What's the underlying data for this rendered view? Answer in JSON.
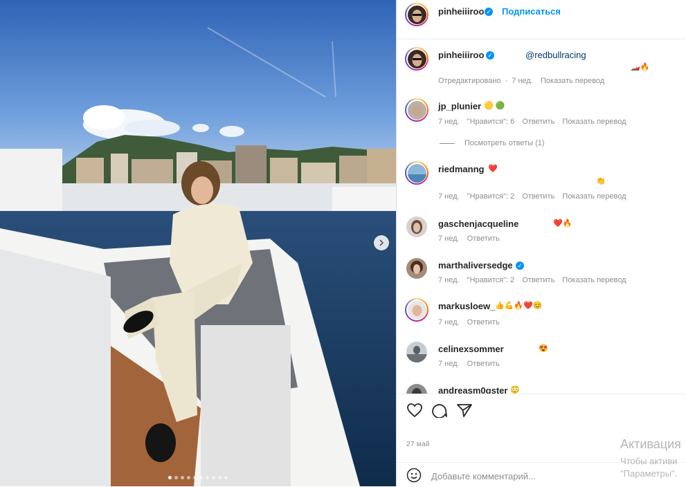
{
  "post": {
    "author": "pinheiiiroo",
    "follow_label": "Подписаться",
    "verified": true,
    "carousel": {
      "total_slides": 10,
      "active_slide": 1
    },
    "caption": {
      "username": "pinheiiiroo",
      "mention": "@redbullracing",
      "emojis": "🏎️🔥",
      "edited_label": "Отредактировано",
      "separator": "·",
      "time": "7 нед.",
      "translate_label": "Показать перевод"
    },
    "comments": [
      {
        "username": "jp_plunier",
        "verified": false,
        "text": "🟡 🟢",
        "time": "7 нед.",
        "likes": "\"Нравится\": 6",
        "reply_label": "Ответить",
        "translate_label": "Показать перевод",
        "view_replies": "Посмотреть ответы (1)"
      },
      {
        "username": "riedmanng",
        "verified": false,
        "text": "❤️",
        "text2": "👏",
        "time": "7 нед.",
        "likes": "\"Нравится\": 2",
        "reply_label": "Ответить",
        "translate_label": "Показать перевод"
      },
      {
        "username": "gaschenjacqueline",
        "verified": false,
        "text": "❤️🔥",
        "time": "7 нед.",
        "reply_label": "Ответить"
      },
      {
        "username": "marthaliversedge",
        "verified": true,
        "text": "",
        "time": "7 нед.",
        "likes": "\"Нравится\": 2",
        "reply_label": "Ответить",
        "translate_label": "Показать перевод"
      },
      {
        "username": "markusloew_",
        "verified": false,
        "text": "👍💪🔥❤️😊",
        "time": "7 нед.",
        "reply_label": "Ответить"
      },
      {
        "username": "celinexsommer",
        "verified": false,
        "text": "😍",
        "time": "7 нед.",
        "reply_label": "Ответить"
      },
      {
        "username": "andreasm0gster",
        "verified": false,
        "text": "😳"
      }
    ],
    "date": "27 май",
    "add_comment_placeholder": "Добавьте комментарий..."
  },
  "icons": {
    "like": "heart-icon",
    "comment": "comment-icon",
    "share": "share-icon",
    "emoji": "emoji-icon",
    "next": "chevron-right-icon"
  },
  "windows_watermark": {
    "line1": "Активация",
    "line2": "Чтобы активи",
    "line3": "\"Параметры\"."
  },
  "colors": {
    "accent": "#0095f6",
    "muted": "#8e8e8e",
    "text": "#262626"
  }
}
